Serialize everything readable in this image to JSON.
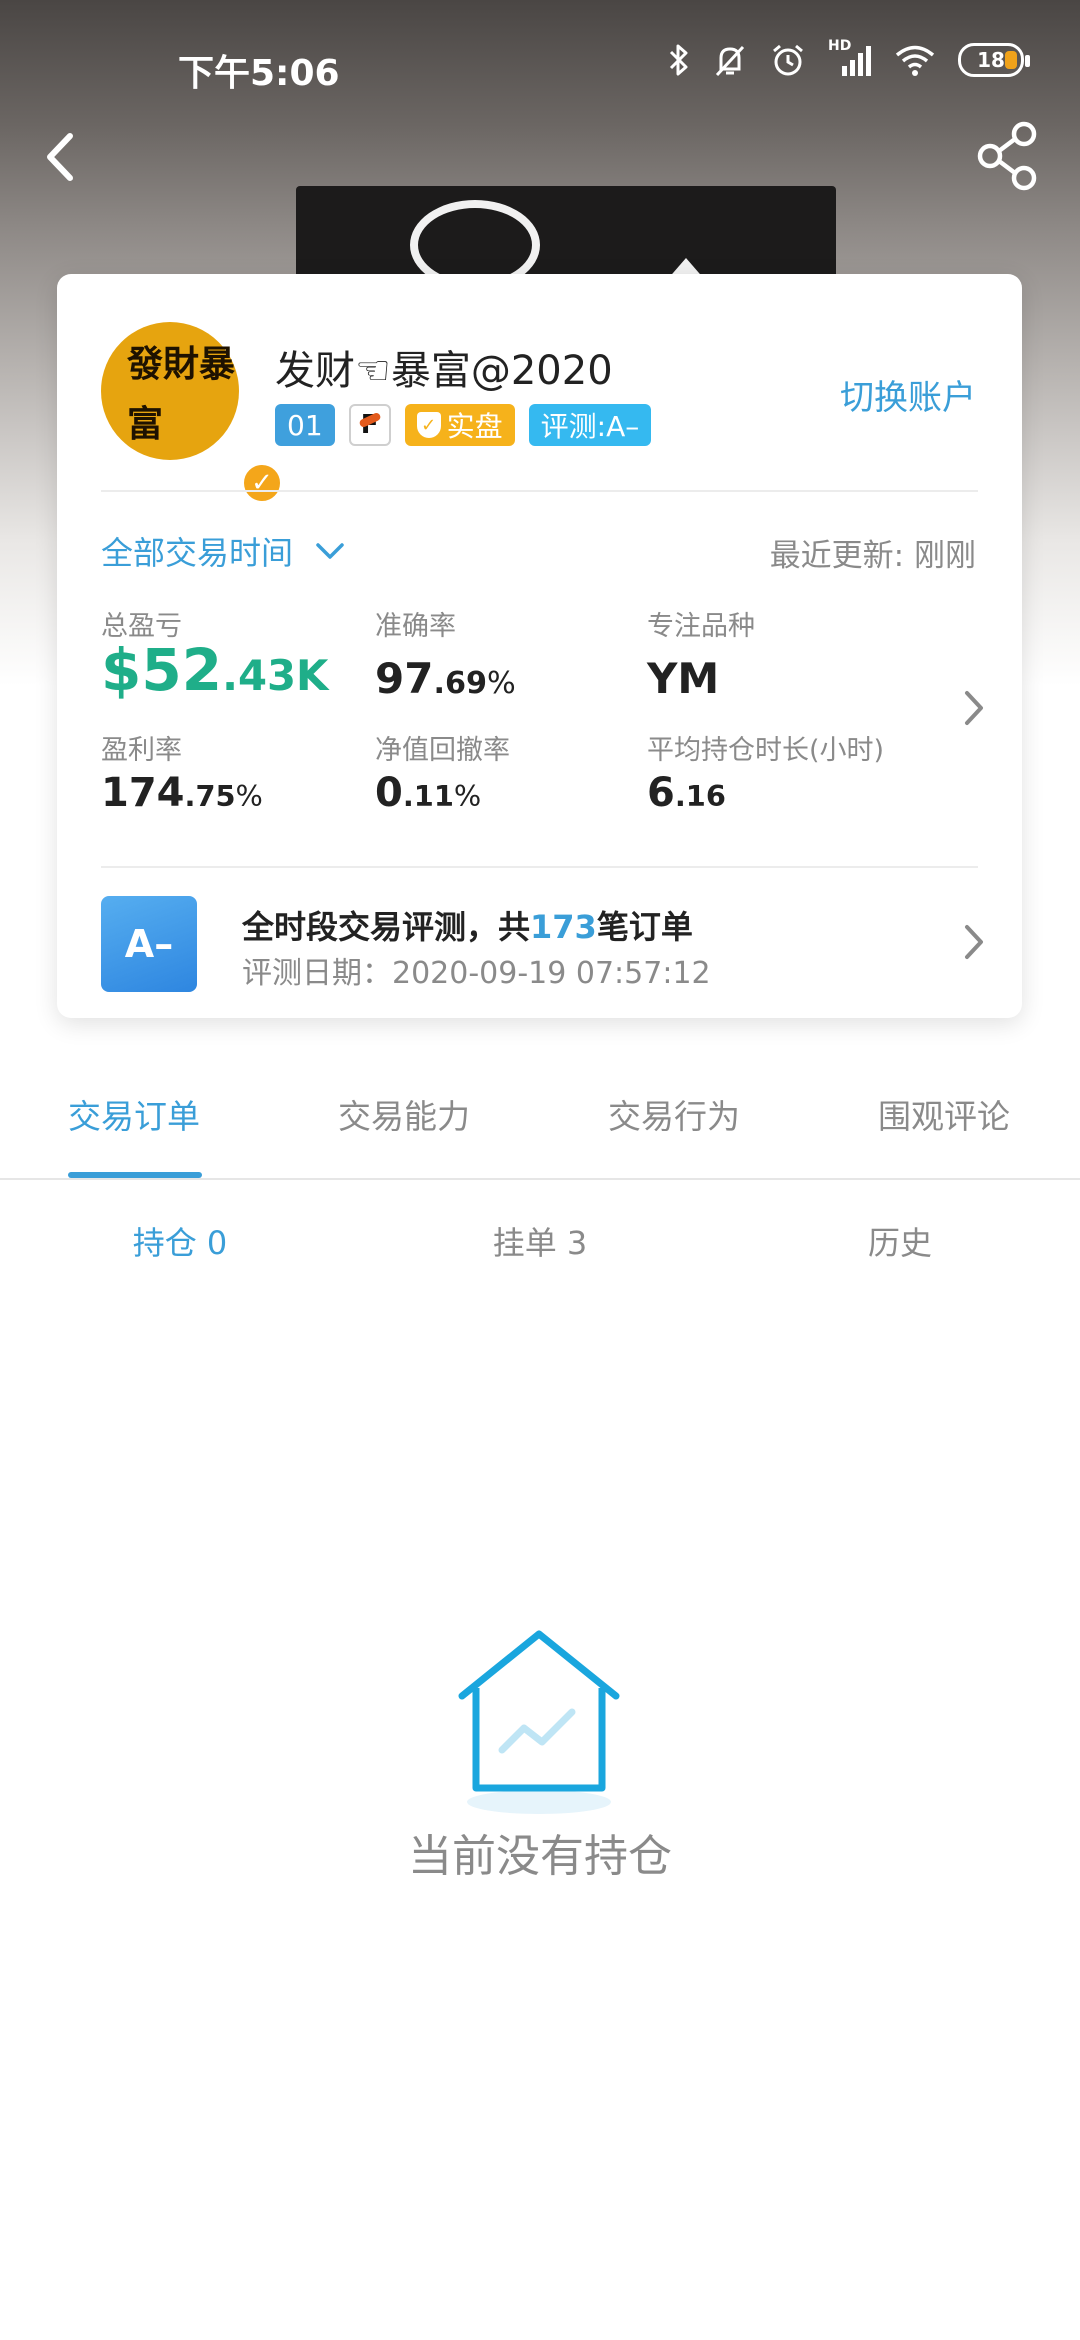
{
  "status_bar": {
    "time": "下午5:06",
    "network_label": "HD",
    "battery_level": "18"
  },
  "profile": {
    "avatar_text": "發財暴富",
    "username": "发财☜暴富@2020",
    "badges": {
      "account_no": "01",
      "broker_letter": "F",
      "live_label": "实盘",
      "rating_label": "评测:A–"
    },
    "switch_account": "切换账户"
  },
  "filter": {
    "time_range": "全部交易时间",
    "last_update": "最近更新: 刚刚"
  },
  "stats": {
    "total_pnl": {
      "label": "总盈亏",
      "prefix": "$",
      "main": "52",
      "suffix": ".43K"
    },
    "accuracy": {
      "label": "准确率",
      "main": "97",
      "decimal": ".69",
      "unit": "%"
    },
    "focus_symbol": {
      "label": "专注品种",
      "value": "YM"
    },
    "profit_rate": {
      "label": "盈利率",
      "main": "174",
      "decimal": ".75",
      "unit": "%"
    },
    "drawdown": {
      "label": "净值回撤率",
      "main": "0",
      "decimal": ".11",
      "unit": "%"
    },
    "avg_hold": {
      "label": "平均持仓时长(小时)",
      "main": "6",
      "decimal": ".16"
    }
  },
  "evaluation": {
    "grade": "A–",
    "title_prefix": "全时段交易评测，共",
    "order_count": "173",
    "title_suffix": "笔订单",
    "date": "评测日期：2020-09-19 07:57:12"
  },
  "tabs": [
    {
      "label": "交易订单",
      "active": true
    },
    {
      "label": "交易能力",
      "active": false
    },
    {
      "label": "交易行为",
      "active": false
    },
    {
      "label": "围观评论",
      "active": false
    }
  ],
  "subtabs": [
    {
      "label": "持仓 0",
      "active": true
    },
    {
      "label": "挂单 3",
      "active": false
    },
    {
      "label": "历史",
      "active": false
    }
  ],
  "empty_state": {
    "icon": "house-chart-icon",
    "message": "当前没有持仓"
  },
  "colors": {
    "accent": "#3a9ed8",
    "profit": "#1fae89",
    "live_badge": "#f6b21b",
    "rating_badge": "#35b9f0"
  }
}
